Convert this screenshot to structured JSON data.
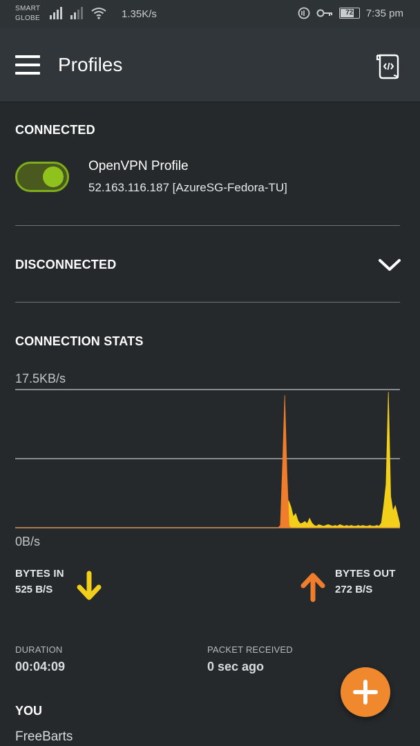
{
  "status_bar": {
    "carrier_line1": "SMART",
    "carrier_line2": "GLOBE",
    "net_speed": "1.35K/s",
    "battery": "72",
    "time": "7:35 pm"
  },
  "app_bar": {
    "title": "Profiles"
  },
  "connected_section": {
    "label": "CONNECTED",
    "profile_name": "OpenVPN Profile",
    "profile_server": "52.163.116.187 [AzureSG-Fedora-TU]",
    "toggle_on": true
  },
  "disconnected_section": {
    "label": "DISCONNECTED"
  },
  "stats_section": {
    "label": "CONNECTION STATS",
    "y_max_label": "17.5KB/s",
    "y_min_label": "0B/s",
    "bytes_in_label": "BYTES IN",
    "bytes_in_value": "525 B/S",
    "bytes_out_label": "BYTES OUT",
    "bytes_out_value": "272 B/S",
    "duration_label": "DURATION",
    "duration_value": "00:04:09",
    "packet_label": "PACKET RECEIVED",
    "packet_value": "0 sec ago"
  },
  "you_section": {
    "label": "YOU",
    "value": "FreeBarts"
  },
  "colors": {
    "accent_green": "#8fc21c",
    "bytes_in_yellow": "#f2cf1a",
    "bytes_out_orange": "#ef7d2b",
    "fab_orange": "#f0892d"
  },
  "chart_data": {
    "type": "area",
    "ylim": [
      0,
      17.5
    ],
    "y_unit": "KB/s",
    "series": [
      {
        "name": "BYTES IN",
        "color": "#f2cf1a",
        "values": [
          0,
          0,
          0,
          0,
          0,
          0,
          0,
          0,
          0,
          0,
          0,
          0,
          0,
          0,
          0,
          0,
          0,
          0,
          0,
          0,
          0,
          0,
          0,
          0,
          0,
          0,
          0,
          0,
          0,
          0,
          0,
          0,
          0,
          0,
          0,
          0,
          0,
          0,
          0,
          0,
          0,
          0,
          0,
          0,
          0,
          0,
          0,
          0,
          0,
          0,
          0,
          0,
          0,
          0,
          0,
          0,
          0,
          0,
          0,
          0,
          0,
          0,
          0,
          0,
          0,
          0,
          0,
          0,
          0,
          0,
          0,
          0,
          0,
          0,
          0,
          0,
          0,
          0,
          0,
          0,
          0,
          0,
          0,
          0,
          0,
          0,
          0,
          0,
          0,
          0,
          0,
          0,
          0,
          0,
          0,
          0,
          0,
          0,
          0,
          0,
          0,
          0,
          0,
          0,
          0,
          0,
          0,
          0,
          0,
          0,
          0,
          0,
          0,
          0,
          0,
          0,
          0.4,
          2.8,
          3.4,
          2.6,
          1.4,
          1.8,
          0.9,
          0.5,
          0.6,
          0.8,
          0.5,
          1.2,
          0.6,
          0.3,
          0.2,
          0.4,
          0.3,
          0.2,
          0.3,
          0.4,
          0.3,
          0.2,
          0.3,
          0.2,
          0.4,
          0.3,
          0.2,
          0.3,
          0.2,
          0.3,
          0.2,
          0.2,
          0.3,
          0.2,
          0.3,
          0.2,
          0.2,
          0.3,
          0.2,
          0.2,
          0.3,
          0.2,
          0.6,
          2.8,
          5.5,
          17.2,
          4.0,
          2.1,
          2.8,
          1.6,
          0.4
        ]
      },
      {
        "name": "BYTES OUT",
        "color": "#ef7d2b",
        "values": [
          0,
          0,
          0,
          0,
          0,
          0,
          0,
          0,
          0,
          0,
          0,
          0,
          0,
          0,
          0,
          0,
          0,
          0,
          0,
          0,
          0,
          0,
          0,
          0,
          0,
          0,
          0,
          0,
          0,
          0,
          0,
          0,
          0,
          0,
          0,
          0,
          0,
          0,
          0,
          0,
          0,
          0,
          0,
          0,
          0,
          0,
          0,
          0,
          0,
          0,
          0,
          0,
          0,
          0,
          0,
          0,
          0,
          0,
          0,
          0,
          0,
          0,
          0,
          0,
          0,
          0,
          0,
          0,
          0,
          0,
          0,
          0,
          0,
          0,
          0,
          0,
          0,
          0,
          0,
          0,
          0,
          0,
          0,
          0,
          0,
          0,
          0,
          0,
          0,
          0,
          0,
          0,
          0,
          0,
          0,
          0,
          0,
          0,
          0,
          0,
          0,
          0,
          0,
          0,
          0,
          0,
          0,
          0,
          0,
          0,
          0,
          0,
          0,
          0,
          0,
          0,
          0,
          0,
          0,
          0,
          0,
          0,
          0.3,
          8.0,
          16.8,
          7.0,
          0.2,
          0,
          0,
          0,
          0,
          0,
          0,
          0,
          0,
          0,
          0,
          0,
          0,
          0,
          0,
          0,
          0,
          0,
          0,
          0,
          0,
          0,
          0,
          0,
          0,
          0,
          0,
          0,
          0,
          0,
          0,
          0,
          0,
          0,
          0,
          0,
          0,
          0,
          0,
          0,
          0,
          0,
          0,
          0,
          0,
          0,
          0,
          0,
          0,
          0,
          0,
          0
        ]
      }
    ],
    "grid": true
  }
}
